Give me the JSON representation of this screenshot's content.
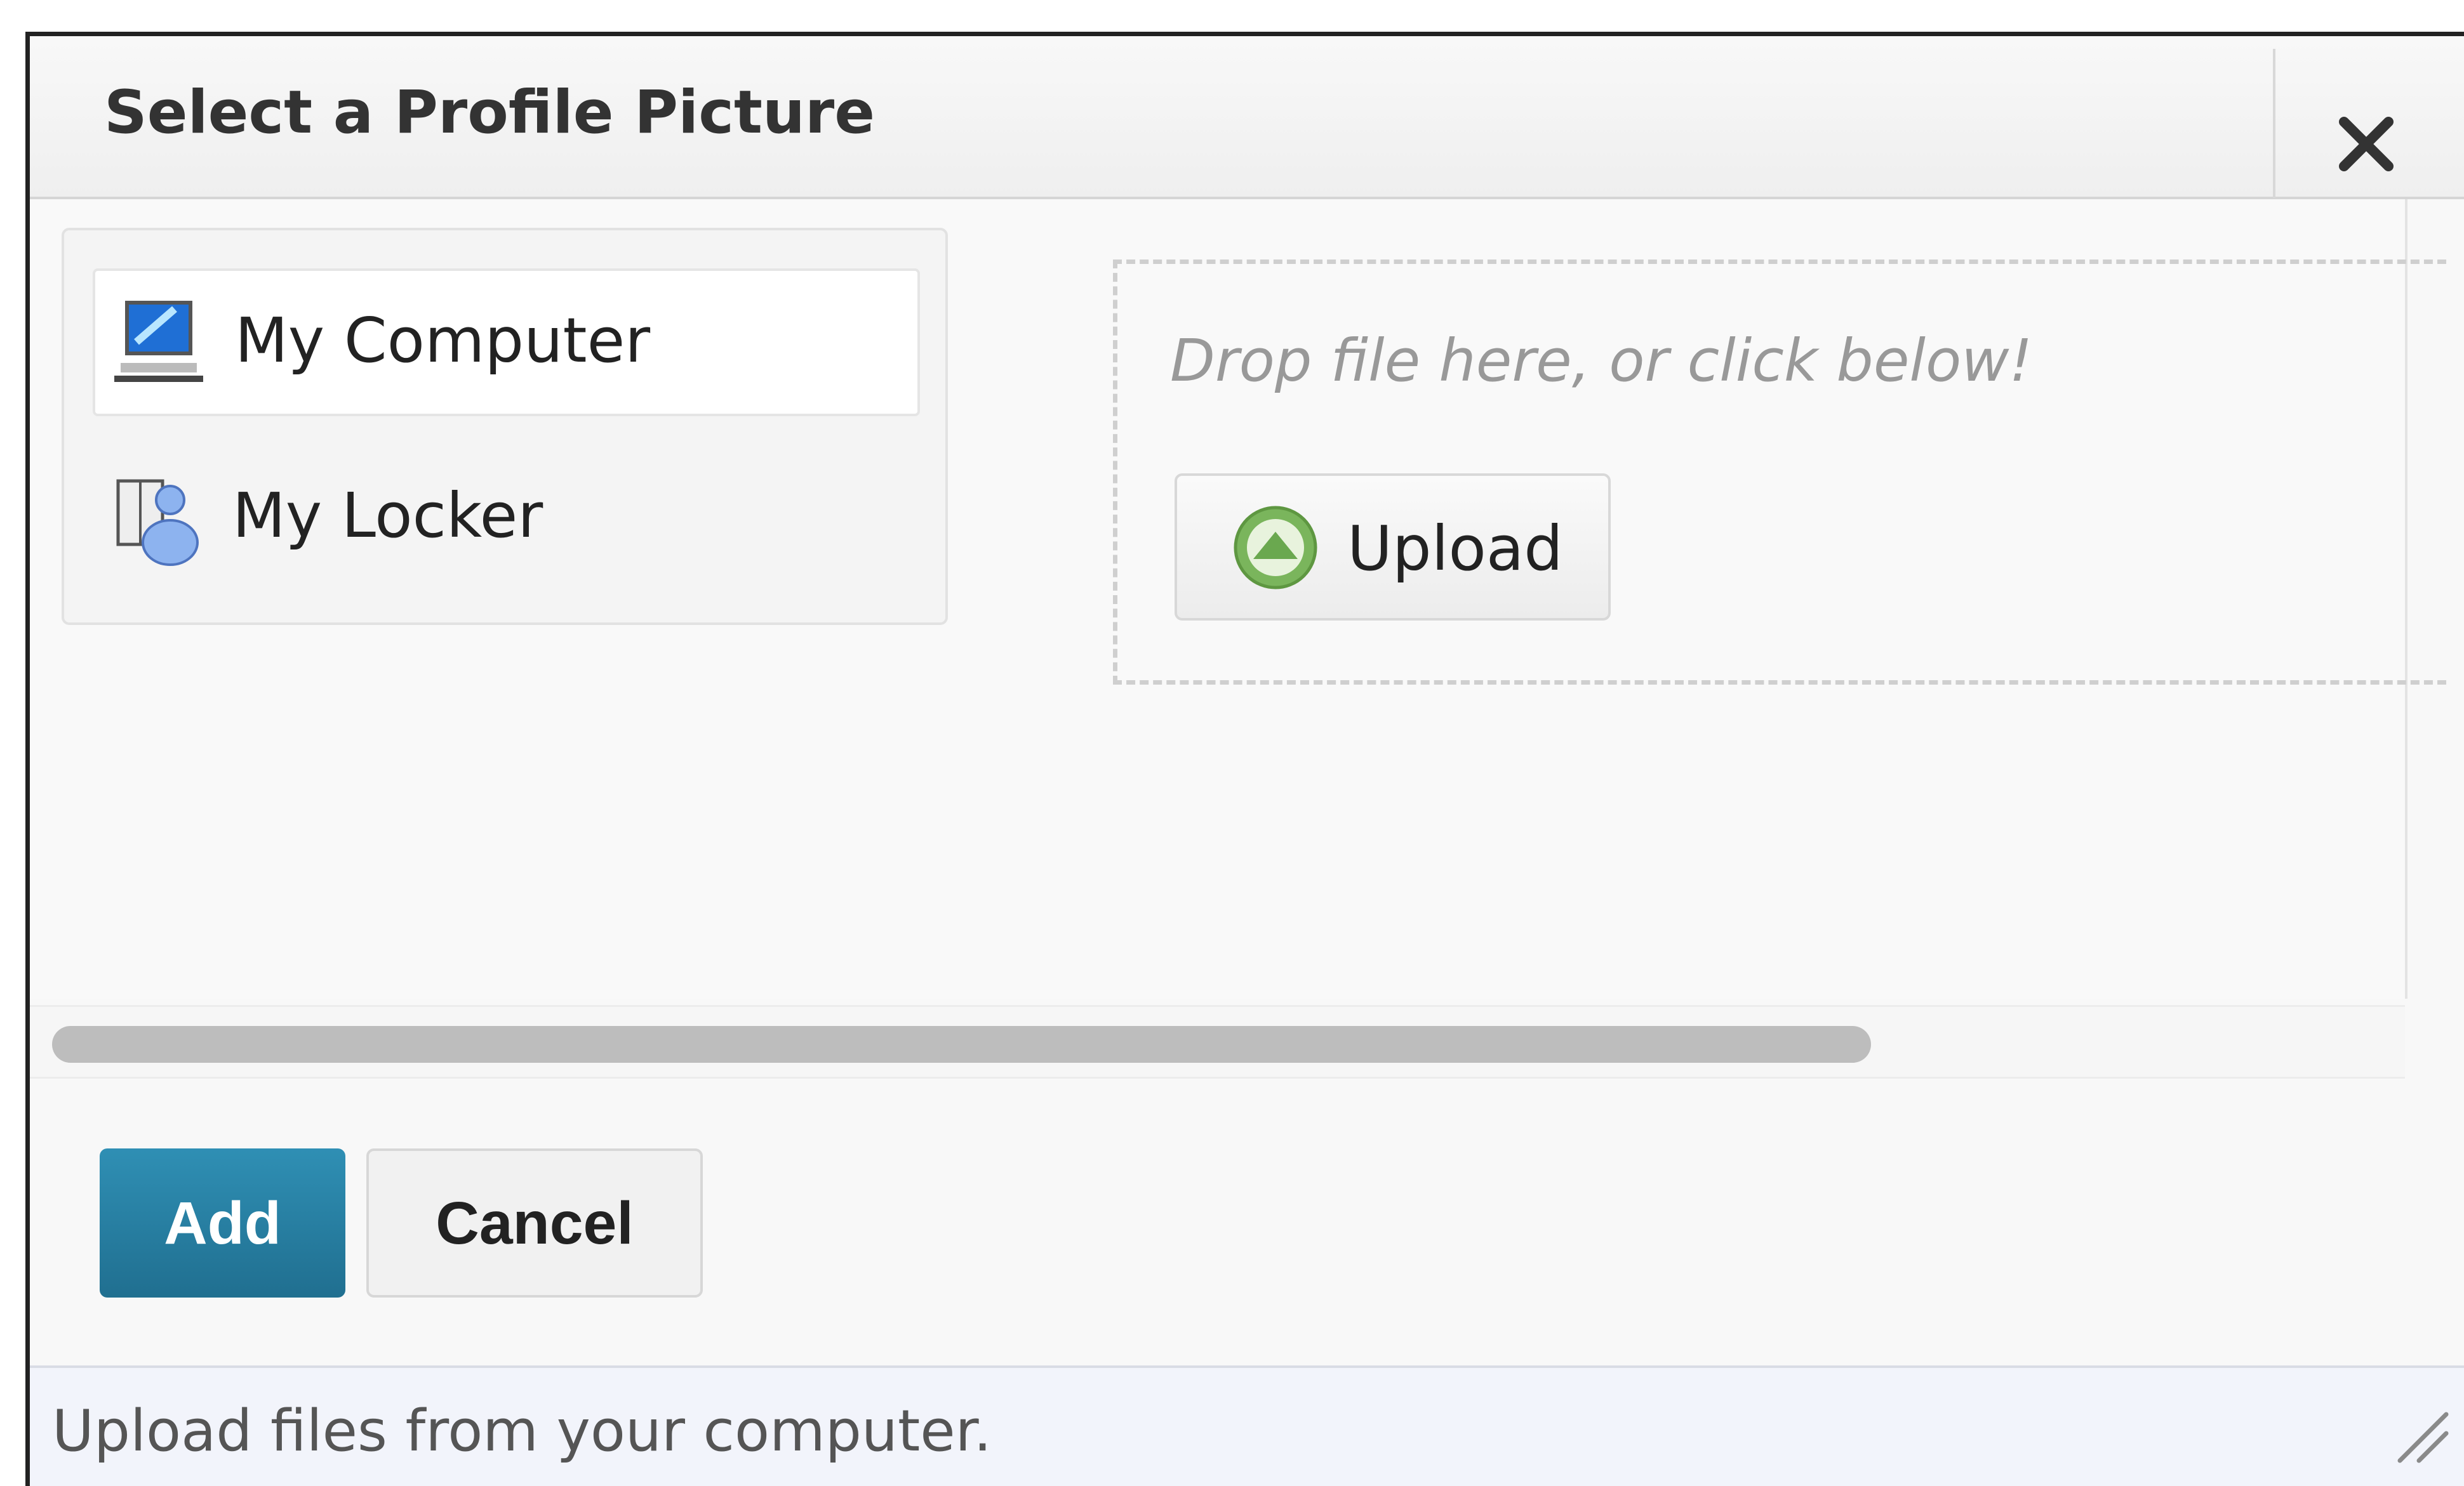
{
  "dialog": {
    "title": "Select a Profile Picture",
    "close_icon": "close-icon"
  },
  "sources": [
    {
      "label": "My Computer",
      "icon": "computer-icon",
      "selected": true
    },
    {
      "label": "My Locker",
      "icon": "locker-icon",
      "selected": false
    }
  ],
  "dropzone": {
    "prompt": "Drop file here, or click below!",
    "upload_label": "Upload",
    "upload_icon": "upload-arrow-icon"
  },
  "actions": {
    "add_label": "Add",
    "cancel_label": "Cancel"
  },
  "footer": {
    "help_text": "Upload files from your computer.",
    "grip_icon": "resize-grip-icon"
  },
  "colors": {
    "primary_button": "#2480a5",
    "upload_icon_green": "#7ab55c"
  }
}
